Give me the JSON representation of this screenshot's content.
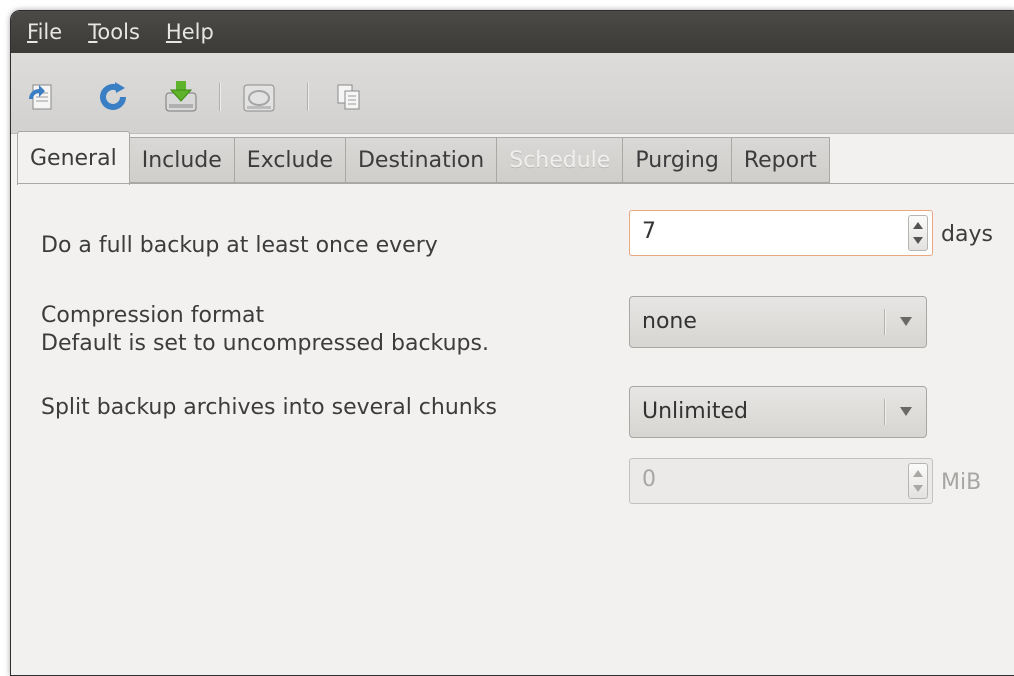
{
  "menu": {
    "file": {
      "mnemonic": "F",
      "rest": "ile"
    },
    "tools": {
      "mnemonic": "T",
      "rest": "ools"
    },
    "help": {
      "mnemonic": "H",
      "rest": "elp"
    }
  },
  "toolbar": {
    "icons": [
      "new-profile-icon",
      "refresh-icon",
      "backup-download-icon",
      "drive-icon",
      "copy-icon"
    ]
  },
  "tabs": [
    "General",
    "Include",
    "Exclude",
    "Destination",
    "Schedule",
    "Purging",
    "Report"
  ],
  "general": {
    "full_backup_label": "Do a full backup at least once every",
    "full_backup_value": "7",
    "full_backup_unit": "days",
    "compression_label_line1": "Compression format",
    "compression_label_line2": "Default is set to uncompressed backups.",
    "compression_value": "none",
    "split_label": "Split backup archives into several chunks",
    "split_value": "Unlimited",
    "chunk_size_value": "0",
    "chunk_size_unit": "MiB"
  },
  "colors": {
    "menubar": "#3c3b37",
    "window_bg": "#f2f1f0",
    "focus_border": "#e9a882"
  }
}
